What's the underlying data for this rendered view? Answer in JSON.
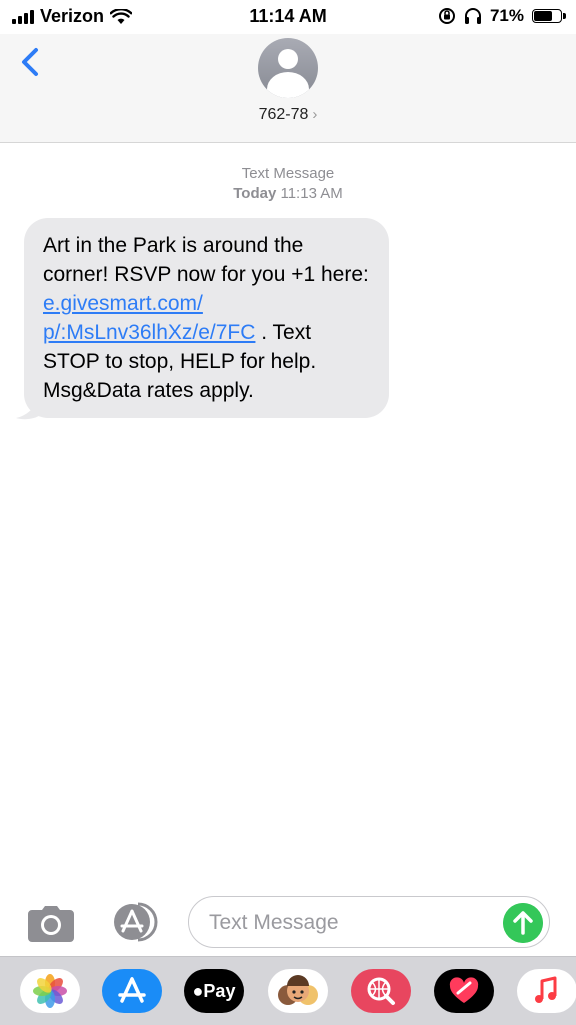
{
  "status_bar": {
    "carrier": "Verizon",
    "time": "11:14 AM",
    "battery": "71%",
    "battery_level": 0.71
  },
  "header": {
    "contact": "762-78",
    "chevron": "›",
    "back_icon": "chevron-left-icon",
    "avatar_icon": "person-silhouette-icon"
  },
  "thread": {
    "service_label": "Text Message",
    "day": "Today",
    "time": "11:13 AM",
    "message": {
      "text_before": "Art in the Park is around the corner! RSVP now for you +1 here: ",
      "link_line1": "e.givesmart.com/",
      "link_line2": "p/:MsLnv36lhXz/e/7FC",
      "text_after": " . Text STOP to stop, HELP for help. Msg&Data rates apply."
    }
  },
  "input_bar": {
    "placeholder": "Text Message",
    "camera_icon": "camera-icon",
    "apps_icon": "app-store-icon",
    "send_icon": "send-arrow-icon"
  },
  "app_drawer": {
    "apple_pay_label": "Pay",
    "apps": [
      "photos-icon",
      "app-store-icon",
      "apple-pay-icon",
      "memoji-icon",
      "web-search-icon",
      "digital-touch-icon",
      "music-icon"
    ]
  },
  "colors": {
    "link": "#2d7cf6",
    "bubble": "#e9e9eb",
    "send": "#34c759",
    "accent": "#1a8cf7"
  }
}
